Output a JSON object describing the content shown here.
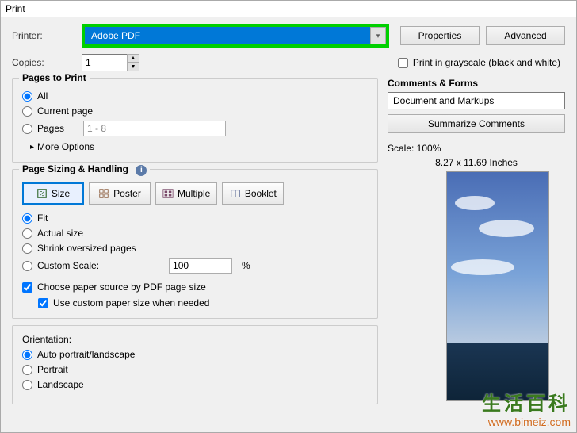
{
  "window": {
    "title": "Print"
  },
  "printerRow": {
    "label": "Printer:",
    "selected": "Adobe PDF",
    "propertiesBtn": "Properties",
    "advancedBtn": "Advanced"
  },
  "copiesRow": {
    "label": "Copies:",
    "value": "1",
    "grayscaleLabel": "Print in grayscale (black and white)"
  },
  "pagesToPrint": {
    "title": "Pages to Print",
    "all": "All",
    "current": "Current page",
    "pagesLabel": "Pages",
    "pagesRange": "1 - 8",
    "moreOptions": "More Options"
  },
  "sizing": {
    "title": "Page Sizing & Handling",
    "tabs": {
      "size": "Size",
      "poster": "Poster",
      "multiple": "Multiple",
      "booklet": "Booklet"
    },
    "fit": "Fit",
    "actual": "Actual size",
    "shrink": "Shrink oversized pages",
    "customScale": "Custom Scale:",
    "customValue": "100",
    "percent": "%",
    "choosePaper": "Choose paper source by PDF page size",
    "useCustom": "Use custom paper size when needed"
  },
  "orientation": {
    "title": "Orientation:",
    "auto": "Auto portrait/landscape",
    "portrait": "Portrait",
    "landscape": "Landscape"
  },
  "comments": {
    "title": "Comments & Forms",
    "selected": "Document and Markups",
    "summarizeBtn": "Summarize Comments"
  },
  "preview": {
    "scale": "Scale: 100%",
    "dims": "8.27 x 11.69 Inches"
  },
  "watermark": {
    "line1": "生活百科",
    "line2": "www.bimeiz.com"
  }
}
